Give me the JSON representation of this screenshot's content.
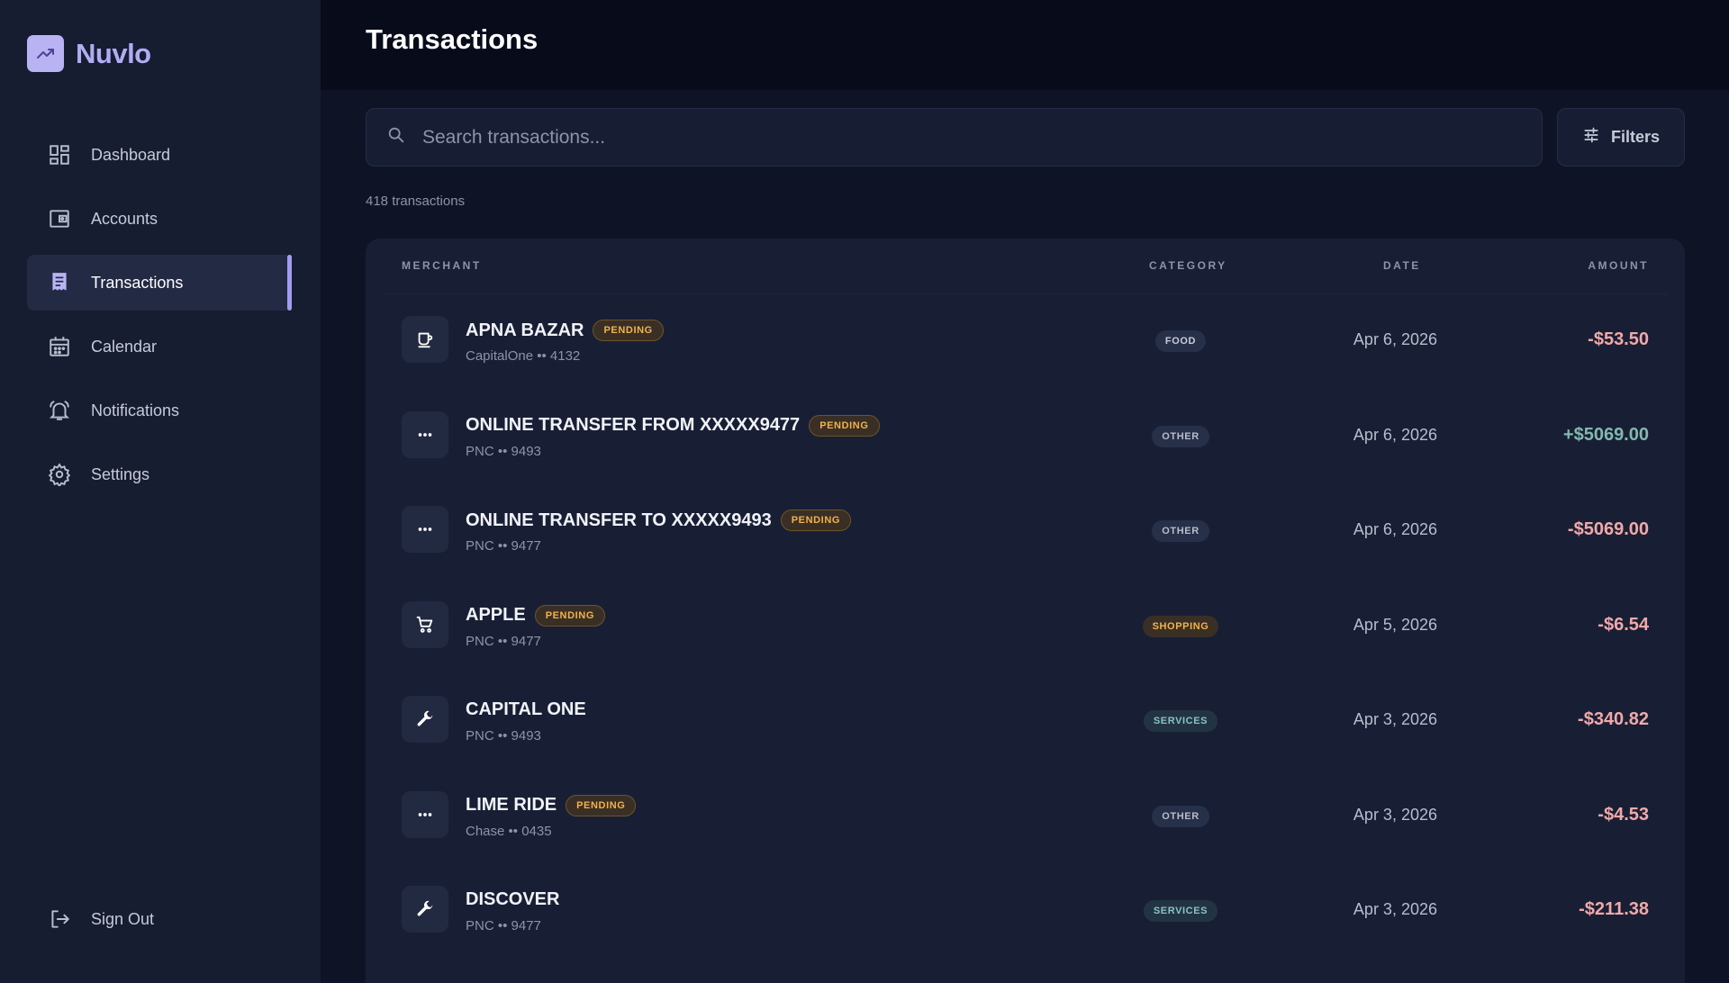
{
  "brand": {
    "name": "Nuvlo",
    "logo_icon": "trending-chart-icon"
  },
  "nav": [
    {
      "label": "Dashboard",
      "icon": "dashboard-icon",
      "active": false
    },
    {
      "label": "Accounts",
      "icon": "wallet-icon",
      "active": false
    },
    {
      "label": "Transactions",
      "icon": "receipt-icon",
      "active": true
    },
    {
      "label": "Calendar",
      "icon": "calendar-icon",
      "active": false
    },
    {
      "label": "Notifications",
      "icon": "bell-icon",
      "active": false
    },
    {
      "label": "Settings",
      "icon": "gear-icon",
      "active": false
    }
  ],
  "signout": {
    "label": "Sign Out",
    "icon": "logout-icon"
  },
  "header": {
    "title": "Transactions"
  },
  "search": {
    "placeholder": "Search transactions...",
    "value": ""
  },
  "filters": {
    "label": "Filters",
    "icon": "sliders-icon"
  },
  "count_text": "418 transactions",
  "table": {
    "columns": {
      "merchant": "MERCHANT",
      "category": "CATEGORY",
      "date": "DATE",
      "amount": "AMOUNT"
    },
    "rows": [
      {
        "icon": "cup-icon",
        "merchant": "APNA BAZAR",
        "pending": "PENDING",
        "account": "CapitalOne •• 4132",
        "category": "FOOD",
        "category_type": "food",
        "date": "Apr 6, 2026",
        "amount": "-$53.50",
        "sign": "neg"
      },
      {
        "icon": "more-icon",
        "merchant": "ONLINE TRANSFER FROM XXXXX9477",
        "pending": "PENDING",
        "account": "PNC •• 9493",
        "category": "OTHER",
        "category_type": "other",
        "date": "Apr 6, 2026",
        "amount": "+$5069.00",
        "sign": "pos"
      },
      {
        "icon": "more-icon",
        "merchant": "ONLINE TRANSFER TO XXXXX9493",
        "pending": "PENDING",
        "account": "PNC •• 9477",
        "category": "OTHER",
        "category_type": "other",
        "date": "Apr 6, 2026",
        "amount": "-$5069.00",
        "sign": "neg"
      },
      {
        "icon": "cart-icon",
        "merchant": "APPLE",
        "pending": "PENDING",
        "account": "PNC •• 9477",
        "category": "SHOPPING",
        "category_type": "shopping",
        "date": "Apr 5, 2026",
        "amount": "-$6.54",
        "sign": "neg"
      },
      {
        "icon": "wrench-icon",
        "merchant": "CAPITAL ONE",
        "pending": "",
        "account": "PNC •• 9493",
        "category": "SERVICES",
        "category_type": "services",
        "date": "Apr 3, 2026",
        "amount": "-$340.82",
        "sign": "neg"
      },
      {
        "icon": "more-icon",
        "merchant": "LIME RIDE",
        "pending": "PENDING",
        "account": "Chase •• 0435",
        "category": "OTHER",
        "category_type": "other",
        "date": "Apr 3, 2026",
        "amount": "-$4.53",
        "sign": "neg"
      },
      {
        "icon": "wrench-icon",
        "merchant": "DISCOVER",
        "pending": "",
        "account": "PNC •• 9477",
        "category": "SERVICES",
        "category_type": "services",
        "date": "Apr 3, 2026",
        "amount": "-$211.38",
        "sign": "neg"
      }
    ]
  },
  "colors": {
    "accent": "#a29cf0",
    "pending": "#f2b24a",
    "negative": "#f1a9a9",
    "positive": "#83b8ae"
  }
}
